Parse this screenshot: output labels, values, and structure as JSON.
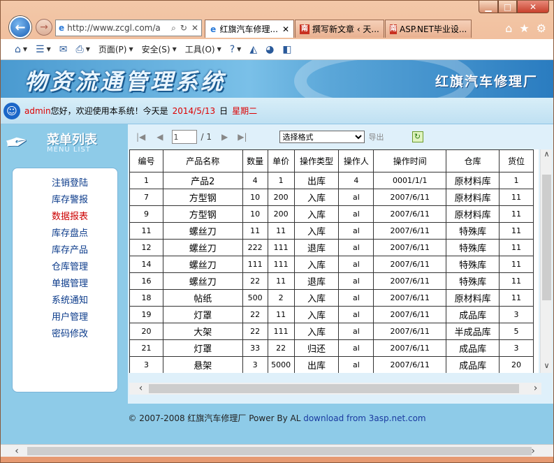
{
  "browser": {
    "address": "http://www.zcgl.com/a",
    "tabs": [
      {
        "label": "红旗汽车修理...",
        "icon": "ie-icon",
        "active": true
      },
      {
        "label": "撰写新文章 ‹ 天...",
        "icon": "site-icon",
        "active": false
      },
      {
        "label": "ASP.NET毕业设...",
        "icon": "site-icon",
        "active": false
      }
    ],
    "menus": [
      "页面(P)",
      "安全(S)",
      "工具(O)"
    ]
  },
  "banner": {
    "title": "物资流通管理系统",
    "company": "红旗汽车修理厂"
  },
  "welcome": {
    "user": "admin",
    "greeting": "您好，欢迎使用本系统！今天是",
    "date": "2014/5/13",
    "day_label": "日",
    "weekday": "星期二"
  },
  "menu": {
    "title_cn": "菜单列表",
    "title_en": "MENU LIST",
    "items": [
      "注销登陆",
      "库存警报",
      "数据报表",
      "库存盘点",
      "库存产品",
      "仓库管理",
      "单据管理",
      "系统通知",
      "用户管理",
      "密码修改"
    ]
  },
  "pager": {
    "page": "1",
    "total": "/ 1",
    "format_select": "选择格式",
    "export": "导出"
  },
  "table": {
    "headers": [
      "编号",
      "产品名称",
      "数量",
      "单价",
      "操作类型",
      "操作人",
      "操作时间",
      "仓库",
      "货位"
    ],
    "rows": [
      [
        "1",
        "产品2",
        "4",
        "1",
        "出库",
        "4",
        "0001/1/1",
        "原材料库",
        "1"
      ],
      [
        "7",
        "方型钢",
        "10",
        "200",
        "入库",
        "al",
        "2007/6/11",
        "原材料库",
        "11"
      ],
      [
        "9",
        "方型钢",
        "10",
        "200",
        "入库",
        "al",
        "2007/6/11",
        "原材料库",
        "11"
      ],
      [
        "11",
        "螺丝刀",
        "11",
        "11",
        "入库",
        "al",
        "2007/6/11",
        "特殊库",
        "11"
      ],
      [
        "12",
        "螺丝刀",
        "222",
        "111",
        "退库",
        "al",
        "2007/6/11",
        "特殊库",
        "11"
      ],
      [
        "14",
        "螺丝刀",
        "111",
        "111",
        "入库",
        "al",
        "2007/6/11",
        "特殊库",
        "11"
      ],
      [
        "16",
        "螺丝刀",
        "22",
        "11",
        "退库",
        "al",
        "2007/6/11",
        "特殊库",
        "11"
      ],
      [
        "18",
        "帖纸",
        "500",
        "2",
        "入库",
        "al",
        "2007/6/11",
        "原材料库",
        "11"
      ],
      [
        "19",
        "灯罩",
        "22",
        "11",
        "入库",
        "al",
        "2007/6/11",
        "成品库",
        "3"
      ],
      [
        "20",
        "大架",
        "22",
        "111",
        "入库",
        "al",
        "2007/6/11",
        "半成品库",
        "5"
      ],
      [
        "21",
        "灯罩",
        "33",
        "22",
        "归还",
        "al",
        "2007/6/11",
        "成品库",
        "3"
      ],
      [
        "3",
        "悬架",
        "3",
        "5000",
        "出库",
        "al",
        "2007/6/11",
        "成品库",
        "20"
      ]
    ]
  },
  "footer": {
    "copyright": "© 2007-2008 红旗汽车修理厂 Power By AL",
    "link": "download from 3asp.net.com"
  }
}
